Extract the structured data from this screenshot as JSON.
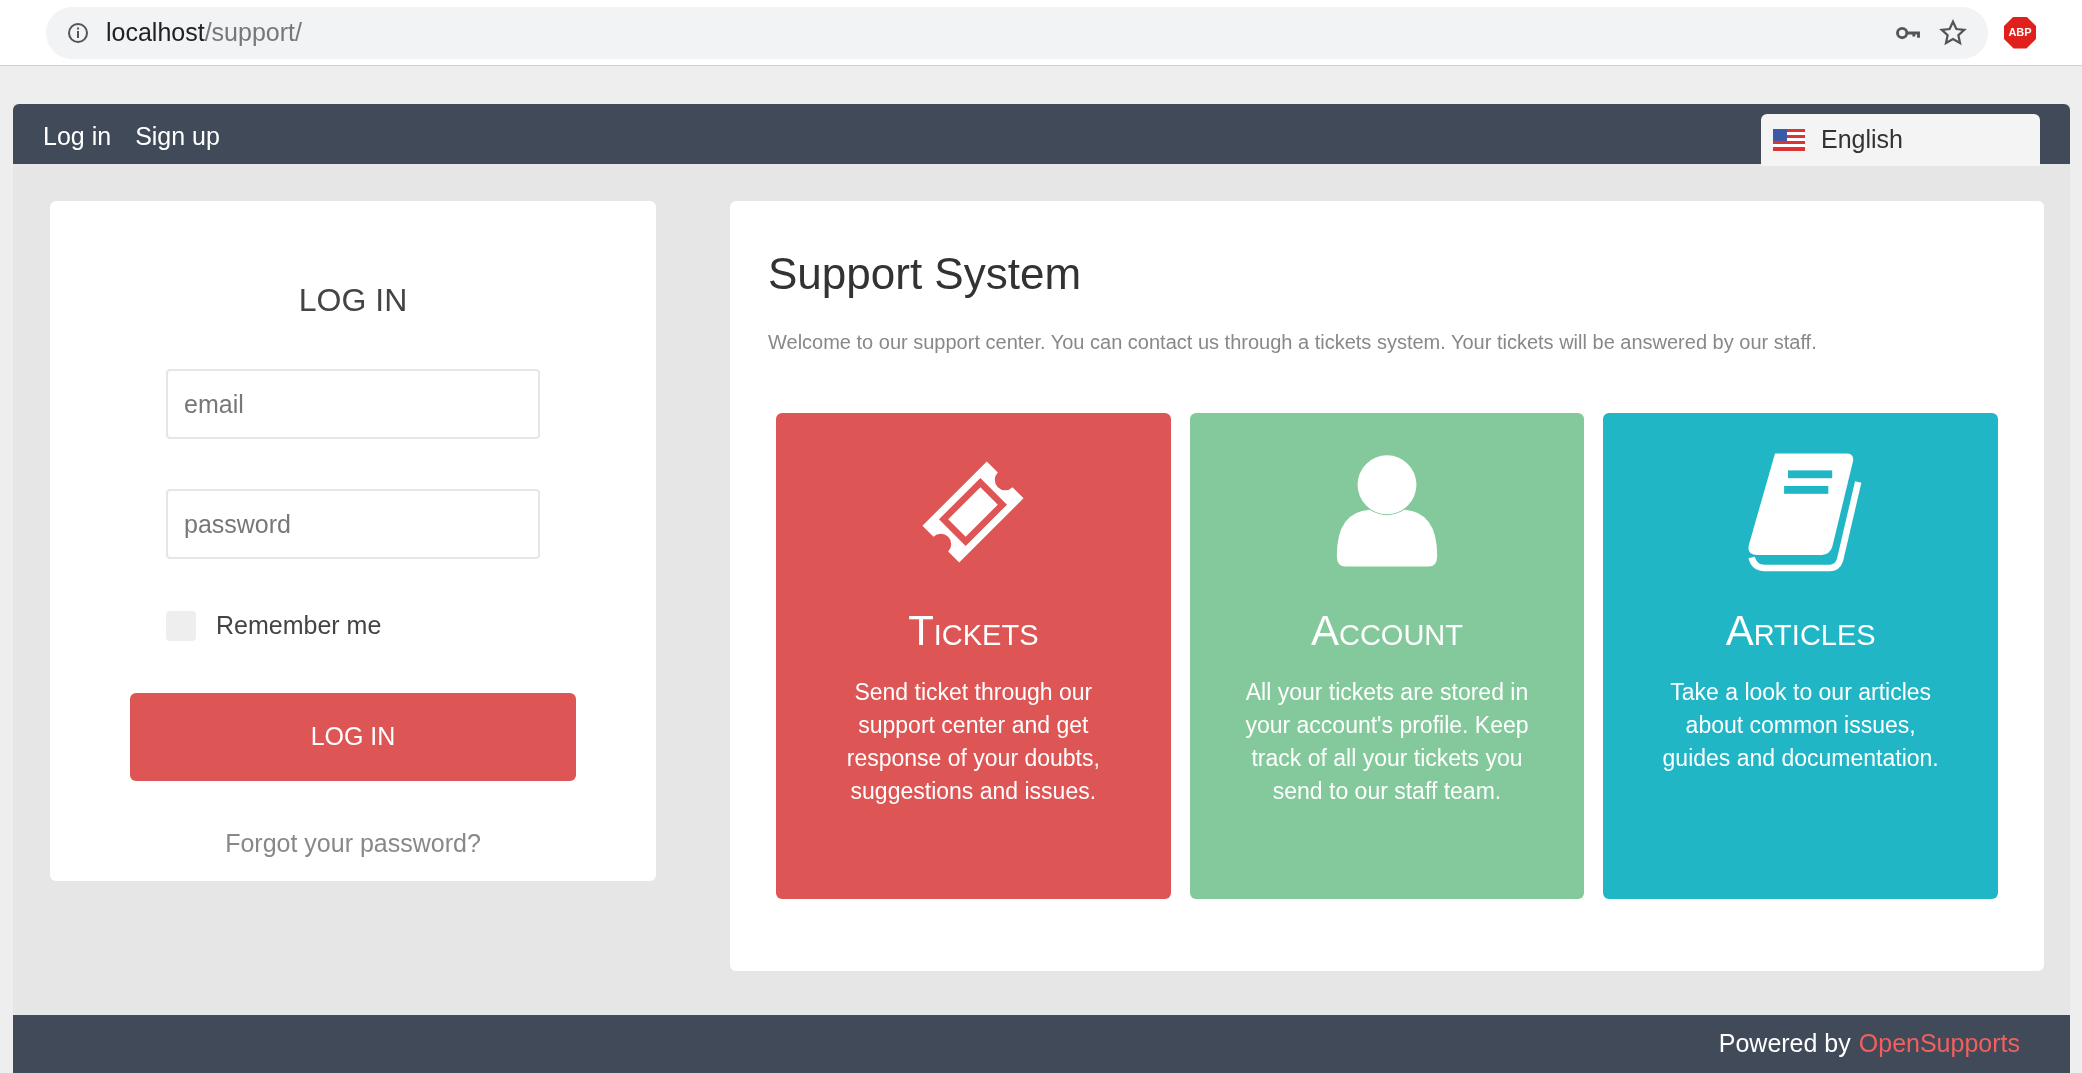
{
  "browser": {
    "url_host": "localhost",
    "url_path": "/support/",
    "extension_badge": "ABP"
  },
  "nav": {
    "links": [
      "Log in",
      "Sign up"
    ],
    "language": "English"
  },
  "login": {
    "title": "LOG IN",
    "email_placeholder": "email",
    "password_placeholder": "password",
    "remember": {
      "label": "Remember me",
      "checked": false
    },
    "button": "LOG IN",
    "forgot": "Forgot your password?"
  },
  "main": {
    "title": "Support System",
    "intro": "Welcome to our support center. You can contact us through a tickets system. Your tickets will be answered by our staff.",
    "tiles": [
      {
        "kind": "ticket",
        "title": "Tickets",
        "text": "Send ticket through our support center and get response of your doubts, suggestions and issues.",
        "color": "#dd5555"
      },
      {
        "kind": "user",
        "title": "Account",
        "text": "All your tickets are stored in your account's profile. Keep track of all your tickets you send to our staff team.",
        "color": "#84c99b"
      },
      {
        "kind": "book",
        "title": "Articles",
        "text": "Take a look to our articles about common issues, guides and documentation.",
        "color": "#20b6c5"
      }
    ]
  },
  "footer": {
    "prefix": "Powered by",
    "brand": "OpenSupports"
  }
}
